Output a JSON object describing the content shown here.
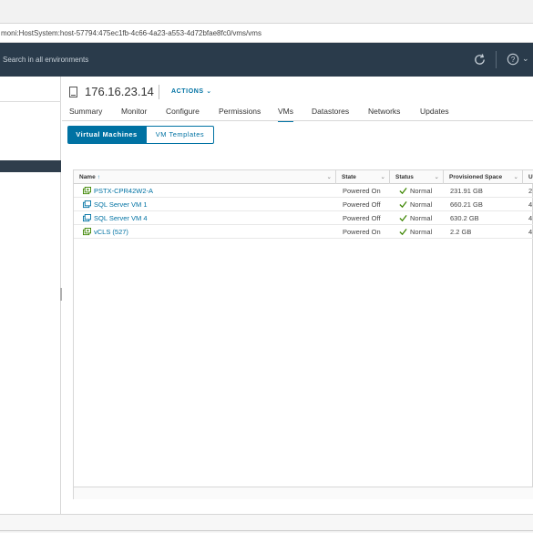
{
  "browser": {
    "url": "moni:HostSystem:host-57794:475ec1fb-4c66-4a23-a553-4d72bfae8fc0/vms/vms"
  },
  "header": {
    "search_placeholder": "Search in all environments",
    "refresh_icon": "refresh-icon",
    "help_icon": "help-icon"
  },
  "host": {
    "name": "176.16.23.14",
    "actions_label": "ACTIONS"
  },
  "tabs": [
    {
      "label": "Summary"
    },
    {
      "label": "Monitor"
    },
    {
      "label": "Configure"
    },
    {
      "label": "Permissions"
    },
    {
      "label": "VMs",
      "active": true
    },
    {
      "label": "Datastores"
    },
    {
      "label": "Networks"
    },
    {
      "label": "Updates"
    }
  ],
  "segments": {
    "vms": "Virtual Machines",
    "templates": "VM Templates"
  },
  "grid": {
    "columns": [
      "Name",
      "State",
      "Status",
      "Provisioned Space",
      "U"
    ],
    "sort_indicator": "↑",
    "rows": [
      {
        "name": "PSTX-CPR42W2-A",
        "state": "Powered On",
        "status": "Normal",
        "space": "231.91 GB",
        "used": "2",
        "icon": "vm-powered-on-icon"
      },
      {
        "name": "SQL Server VM 1",
        "state": "Powered Off",
        "status": "Normal",
        "space": "660.21 GB",
        "used": "4",
        "icon": "vm-powered-off-icon"
      },
      {
        "name": "SQL Server VM 4",
        "state": "Powered Off",
        "status": "Normal",
        "space": "630.2 GB",
        "used": "4",
        "icon": "vm-powered-off-icon"
      },
      {
        "name": "vCLS (527)",
        "state": "Powered On",
        "status": "Normal",
        "space": "2.2 GB",
        "used": "4",
        "icon": "vm-powered-on-icon"
      }
    ]
  },
  "colors": {
    "accent": "#0072a3",
    "header_bg": "#2a3b4b",
    "status_ok": "#3c8500"
  }
}
